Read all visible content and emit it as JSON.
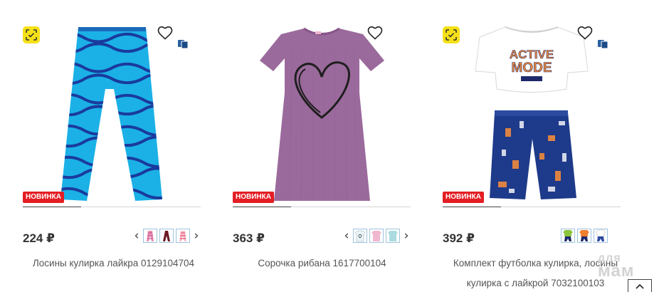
{
  "products": [
    {
      "price": "224 ₽",
      "title": "Лосины кулирка лайкра 0129104704",
      "badge": "НОВИНКА",
      "image_icon": "zebra-print-leggings-image",
      "colors": {
        "swatch_1": "#e891b7",
        "swatch_2": "#6b1a24",
        "swatch_3": "#e8506f",
        "main": "#1bb1e6",
        "stripe": "#1a3a9e"
      }
    },
    {
      "price": "363 ₽",
      "title": "Сорочка рибана 1617700104",
      "badge": "НОВИНКА",
      "image_icon": "purple-nightgown-image",
      "colors": {
        "swatch_1": "#e8f4f8",
        "swatch_2": "#f0b7cf",
        "swatch_3": "#a9dbe0",
        "main": "#9b6a9c"
      }
    },
    {
      "price": "392 ₽",
      "title_line1": "Комплект футболка кулирка, лосины",
      "title_line2": "кулирка с лайкрой 7032100103",
      "badge": "НОВИНКА",
      "image_icon": "tshirt-shorts-set-image",
      "tshirt_text_1": "ACTIVE",
      "tshirt_text_2": "MODE",
      "colors": {
        "swatch_1": "#8cc63e",
        "swatch_2": "#f07f2d",
        "swatch_3": "#ffffff",
        "main": "#1e3a8a",
        "accent": "#f08a3c"
      }
    }
  ],
  "watermark": {
    "line1": "для",
    "line2": "мам"
  },
  "icons": {
    "quick_view": "scan-icon",
    "wishlist": "heart-outline-icon",
    "similar": "similar-items-icon",
    "prev": "chevron-left-icon",
    "next": "chevron-right-icon",
    "scroll_top": "chevron-up-icon"
  }
}
